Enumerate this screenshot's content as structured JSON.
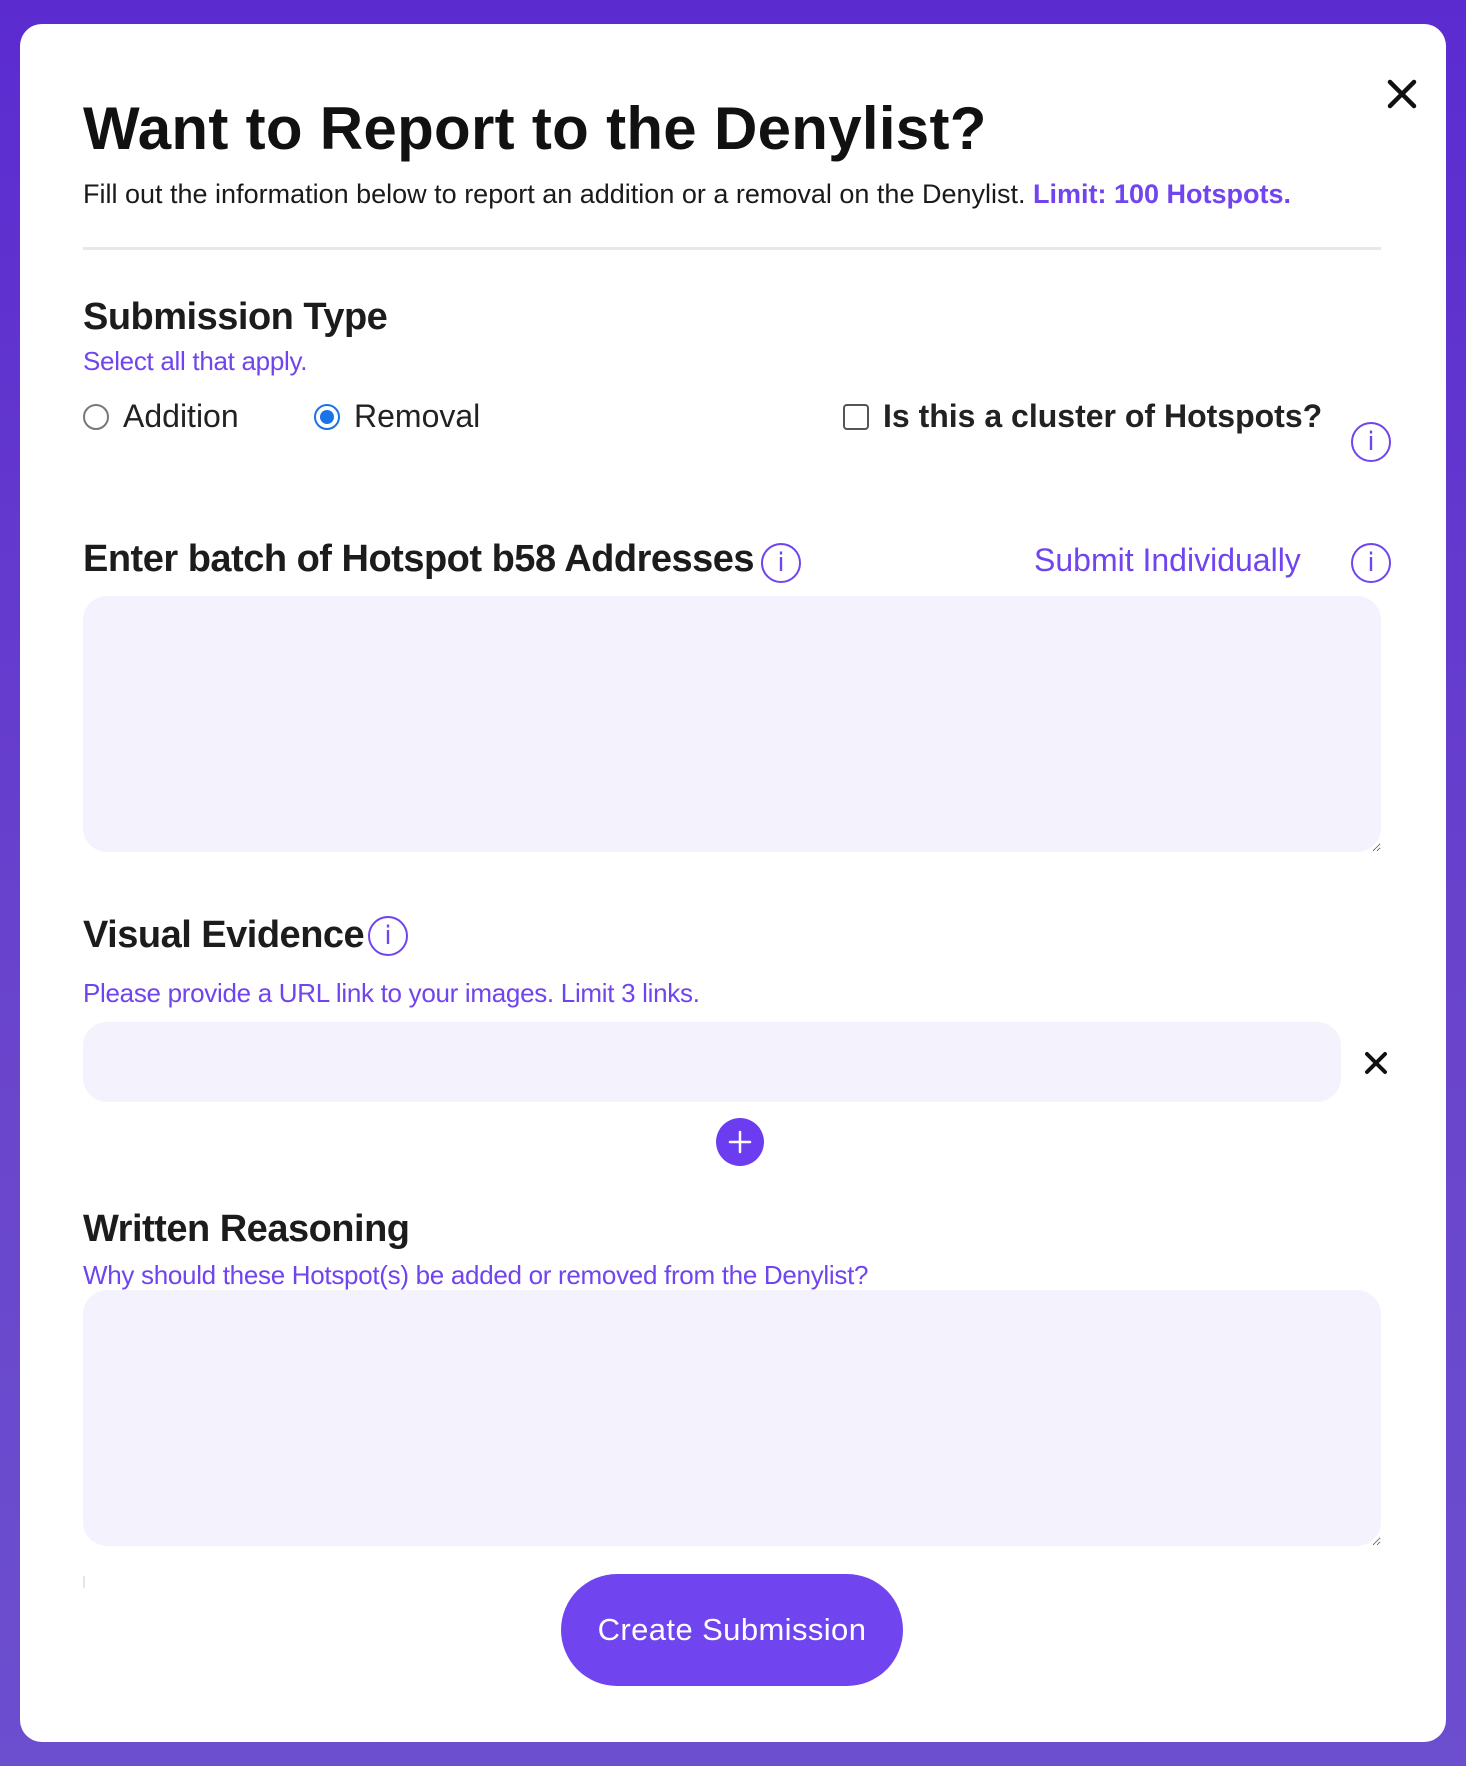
{
  "modal": {
    "title": "Want to Report to the Denylist?",
    "subtitle": "Fill out the information below to report an addition or a removal on the Denylist.",
    "limit": "Limit: 100 Hotspots.",
    "close_icon": "close-icon"
  },
  "submission_type": {
    "heading": "Submission Type",
    "hint": "Select all that apply.",
    "options": [
      {
        "label": "Addition",
        "selected": false
      },
      {
        "label": "Removal",
        "selected": true
      }
    ],
    "cluster_label": "Is this a cluster of Hotspots?",
    "cluster_checked": false
  },
  "addresses": {
    "heading": "Enter batch of Hotspot b58 Addresses",
    "submit_individually": "Submit Individually",
    "value": ""
  },
  "visual_evidence": {
    "heading": "Visual Evidence",
    "hint": "Please provide a URL link to your images. Limit 3 links.",
    "url_value": ""
  },
  "written_reasoning": {
    "heading": "Written Reasoning",
    "hint": "Why should these Hotspot(s) be added or removed from the Denylist?",
    "value": ""
  },
  "actions": {
    "create_label": "Create Submission"
  },
  "colors": {
    "accent": "#7044ee",
    "field_bg": "#f4f2fd",
    "radio_selected": "#1a73e8",
    "backdrop": "#5b2bd0"
  }
}
